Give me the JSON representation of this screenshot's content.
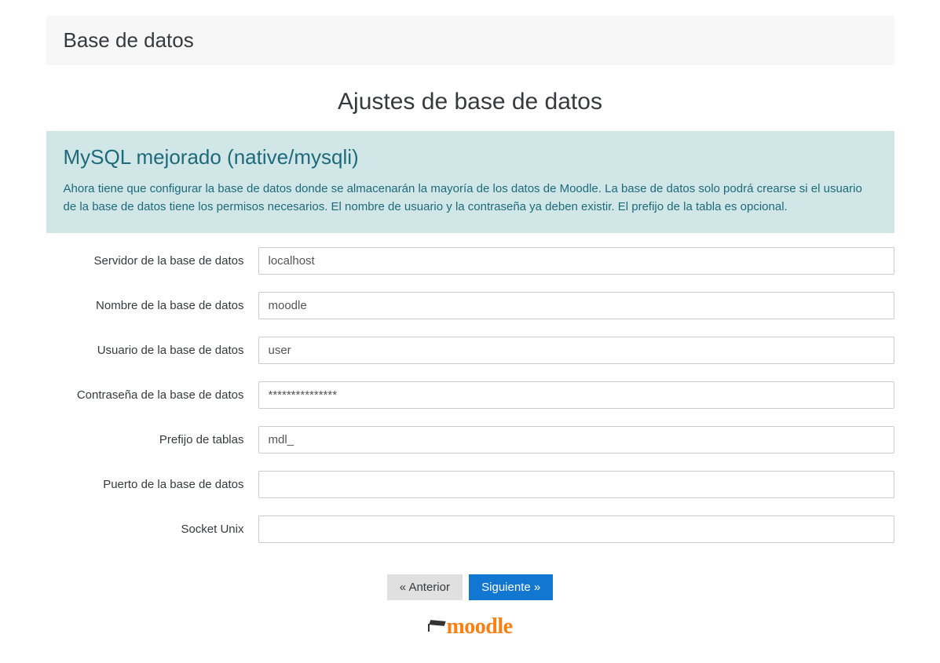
{
  "header": {
    "title": "Base de datos"
  },
  "page": {
    "heading": "Ajustes de base de datos"
  },
  "info": {
    "title": "MySQL mejorado (native/mysqli)",
    "description": "Ahora tiene que configurar la base de datos donde se almacenarán la mayoría de los datos de Moodle. La base de datos solo podrá crearse si el usuario de la base de datos tiene los permisos necesarios. El nombre de usuario y la contraseña ya deben existir. El prefijo de la tabla es opcional."
  },
  "form": {
    "fields": [
      {
        "label": "Servidor de la base de datos",
        "value": "localhost",
        "type": "text",
        "name": "dbhost"
      },
      {
        "label": "Nombre de la base de datos",
        "value": "moodle",
        "type": "text",
        "name": "dbname"
      },
      {
        "label": "Usuario de la base de datos",
        "value": "user",
        "type": "text",
        "name": "dbuser"
      },
      {
        "label": "Contraseña de la base de datos",
        "value": "***************",
        "type": "text",
        "name": "dbpass"
      },
      {
        "label": "Prefijo de tablas",
        "value": "mdl_",
        "type": "text",
        "name": "prefix"
      },
      {
        "label": "Puerto de la base de datos",
        "value": "",
        "type": "text",
        "name": "dbport"
      },
      {
        "label": "Socket Unix",
        "value": "",
        "type": "text",
        "name": "dbsocket"
      }
    ]
  },
  "buttons": {
    "prev": "« Anterior",
    "next": "Siguiente »"
  },
  "logo": {
    "text": "moodle"
  }
}
